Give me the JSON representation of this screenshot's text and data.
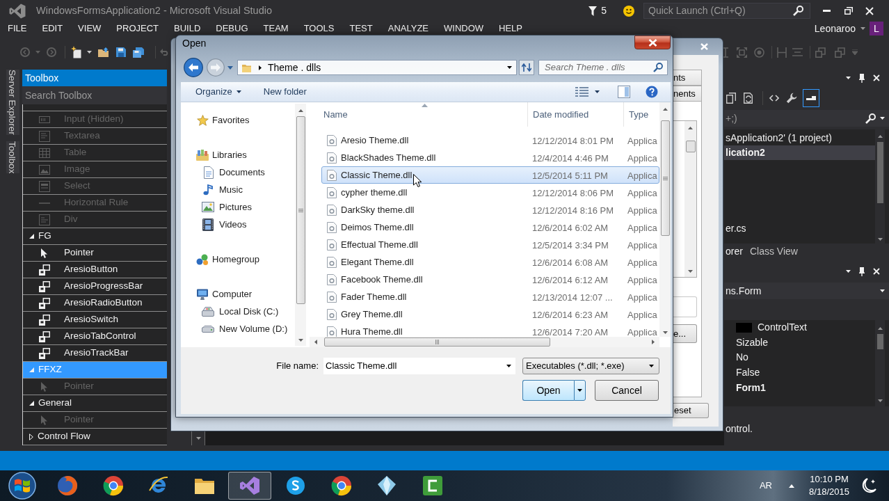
{
  "window": {
    "title": "WindowsFormsApplication2 - Microsoft Visual Studio",
    "notification_count": "5",
    "quick_launch": {
      "placeholder": "Quick Launch (Ctrl+Q)"
    }
  },
  "menu": [
    "FILE",
    "EDIT",
    "VIEW",
    "PROJECT",
    "BUILD",
    "DEBUG",
    "TEAM",
    "TOOLS",
    "TEST",
    "ANALYZE",
    "WINDOW",
    "HELP"
  ],
  "account": {
    "name": "Leonaroo",
    "initial": "L"
  },
  "side_tabs": [
    "Server Explorer",
    "Toolbox"
  ],
  "toolbox": {
    "title": "Toolbox",
    "search": {
      "placeholder": "Search Toolbox"
    },
    "items": [
      {
        "kind": "html",
        "label": "Input (Hidden)",
        "disabled": true
      },
      {
        "kind": "html",
        "label": "Textarea",
        "disabled": true
      },
      {
        "kind": "html",
        "label": "Table",
        "disabled": true
      },
      {
        "kind": "html",
        "label": "Image",
        "disabled": true
      },
      {
        "kind": "html",
        "label": "Select",
        "disabled": true
      },
      {
        "kind": "html",
        "label": "Horizontal Rule",
        "disabled": true
      },
      {
        "kind": "html",
        "label": "Div",
        "disabled": true
      },
      {
        "kind": "group",
        "label": "FG",
        "expanded": true,
        "selected": false,
        "children": [
          {
            "kind": "pointer",
            "label": "Pointer",
            "disabled": false
          },
          {
            "kind": "control",
            "label": "AresioButton",
            "disabled": false
          },
          {
            "kind": "control",
            "label": "AresioProgressBar",
            "disabled": false
          },
          {
            "kind": "control",
            "label": "AresioRadioButton",
            "disabled": false
          },
          {
            "kind": "control",
            "label": "AresioSwitch",
            "disabled": false
          },
          {
            "kind": "control",
            "label": "AresioTabControl",
            "disabled": false
          },
          {
            "kind": "control",
            "label": "AresioTrackBar",
            "disabled": false
          }
        ]
      },
      {
        "kind": "group",
        "label": "FFXZ",
        "expanded": true,
        "selected": true,
        "children": [
          {
            "kind": "pointer",
            "label": "Pointer",
            "disabled": true
          }
        ]
      },
      {
        "kind": "group",
        "label": "General",
        "expanded": true,
        "selected": false,
        "children": [
          {
            "kind": "pointer",
            "label": "Pointer",
            "disabled": true
          }
        ]
      },
      {
        "kind": "group",
        "label": "Control Flow",
        "expanded": false,
        "selected": false
      }
    ]
  },
  "choose_toolbox_items_dialog": {
    "tabs": [
      "nts",
      "nents"
    ],
    "buttons": [
      "e...",
      "eset"
    ]
  },
  "open_dialog": {
    "title": "Open",
    "address": "Theme . dlls",
    "search": {
      "placeholder": "Search Theme . dlls"
    },
    "commands": [
      "Organize",
      "New folder"
    ],
    "nav": [
      {
        "label": "Favorites"
      },
      {
        "label": "Libraries",
        "children": [
          {
            "label": "Documents"
          },
          {
            "label": "Music"
          },
          {
            "label": "Pictures"
          },
          {
            "label": "Videos"
          }
        ]
      },
      {
        "label": "Homegroup"
      },
      {
        "label": "Computer",
        "children": [
          {
            "label": "Local Disk (C:)"
          },
          {
            "label": "New Volume (D:)"
          }
        ]
      }
    ],
    "columns": [
      "Name",
      "Date modified",
      "Type"
    ],
    "files": [
      {
        "name": "Aresio Theme.dll",
        "date": "12/12/2014 8:01 PM",
        "type": "Applica",
        "selected": false
      },
      {
        "name": "BlackShades Theme.dll",
        "date": "12/4/2014 4:46 PM",
        "type": "Applica",
        "selected": false
      },
      {
        "name": "Classic Theme.dll",
        "date": "12/5/2014 5:11 PM",
        "type": "Applica",
        "selected": true
      },
      {
        "name": "cypher theme.dll",
        "date": "12/12/2014 8:06 PM",
        "type": "Applica",
        "selected": false
      },
      {
        "name": "DarkSky theme.dll",
        "date": "12/12/2014 8:16 PM",
        "type": "Applica",
        "selected": false
      },
      {
        "name": "Deimos Theme.dll",
        "date": "12/6/2014 6:02 AM",
        "type": "Applica",
        "selected": false
      },
      {
        "name": "Effectual Theme.dll",
        "date": "12/5/2014 3:34 PM",
        "type": "Applica",
        "selected": false
      },
      {
        "name": "Elegant Theme.dll",
        "date": "12/6/2014 6:08 AM",
        "type": "Applica",
        "selected": false
      },
      {
        "name": "Facebook Theme.dll",
        "date": "12/6/2014 6:12 AM",
        "type": "Applica",
        "selected": false
      },
      {
        "name": "Fader Theme.dll",
        "date": "12/13/2014 12:07 ...",
        "type": "Applica",
        "selected": false
      },
      {
        "name": "Grey Theme.dll",
        "date": "12/6/2014 6:23 AM",
        "type": "Applica",
        "selected": false
      },
      {
        "name": "Hura Theme.dll",
        "date": "12/6/2014 7:20 AM",
        "type": "Applica",
        "selected": false
      }
    ],
    "file_name": {
      "label": "File name:",
      "value": "Classic Theme.dll"
    },
    "file_type": "Executables (*.dll; *.exe)",
    "buttons": [
      {
        "label": "Open",
        "kind": "split",
        "default": true
      },
      {
        "label": "Cancel",
        "kind": "plain",
        "default": false
      }
    ]
  },
  "solution_explorer": {
    "search": {
      "placeholder": "+;)"
    },
    "tree": [
      {
        "label": "sApplication2' (1 project)",
        "selected": false,
        "startup": false
      },
      {
        "label": "lication2",
        "selected": true,
        "startup": true
      },
      {
        "label": "er.cs",
        "selected": false,
        "startup": false
      }
    ],
    "tabs": [
      {
        "label": "orer",
        "selected": true
      },
      {
        "label": "Class View",
        "selected": false
      }
    ]
  },
  "properties": {
    "object": "ns.Form",
    "rows": [
      {
        "kind": "color",
        "color": "#000000",
        "value": "ControlText",
        "changed": false
      },
      {
        "kind": "text",
        "value": "Sizable",
        "changed": false
      },
      {
        "kind": "text",
        "value": "No",
        "changed": false
      },
      {
        "kind": "text",
        "value": "False",
        "changed": false
      },
      {
        "kind": "text",
        "value": "Form1",
        "changed": true
      }
    ],
    "description": "ontrol."
  },
  "taskbar": {
    "apps": [
      {
        "active": false
      },
      {
        "active": false
      },
      {
        "active": false
      },
      {
        "active": false
      },
      {
        "active": true
      },
      {
        "active": false
      },
      {
        "active": false
      },
      {
        "active": false
      },
      {
        "active": false
      }
    ],
    "language": "AR",
    "time": "10:10 PM",
    "date": "8/18/2015"
  }
}
